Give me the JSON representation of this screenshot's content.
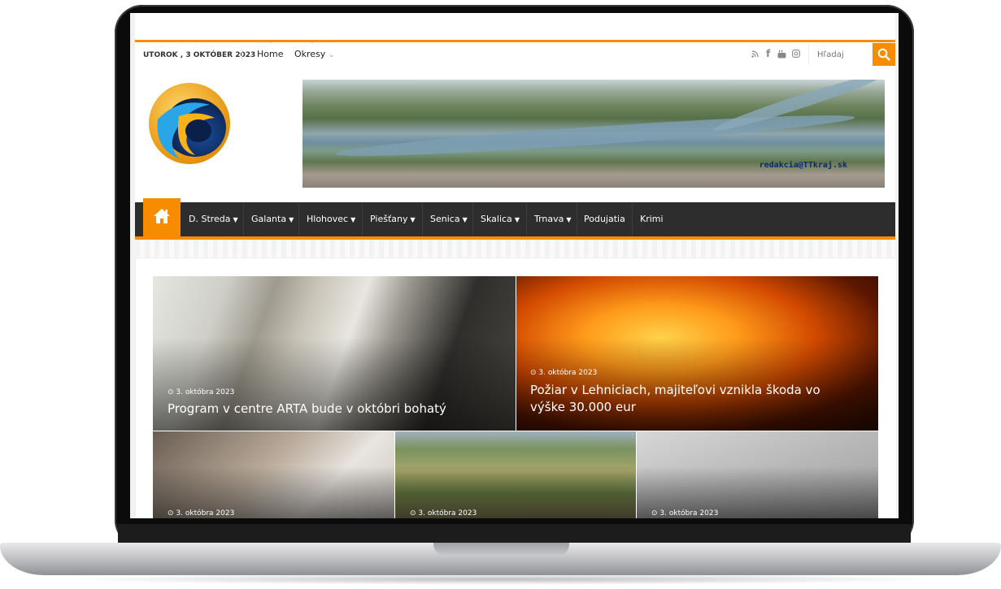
{
  "topbar": {
    "date": "UTOROK , 3 OKTÓBER 2023",
    "links": [
      {
        "label": "Home"
      },
      {
        "label": "Okresy"
      }
    ],
    "social_icons": [
      "rss-icon",
      "facebook-icon",
      "youtube-icon",
      "instagram-icon"
    ],
    "search_placeholder": "Hľadaj"
  },
  "header": {
    "banner_email": "redakcia@TTkraj.sk"
  },
  "nav": {
    "items": [
      {
        "label": "D. Streda",
        "dropdown": true
      },
      {
        "label": "Galanta",
        "dropdown": true
      },
      {
        "label": "Hlohovec",
        "dropdown": true
      },
      {
        "label": "Piešťany",
        "dropdown": true
      },
      {
        "label": "Senica",
        "dropdown": true
      },
      {
        "label": "Skalica",
        "dropdown": true
      },
      {
        "label": "Trnava",
        "dropdown": true
      },
      {
        "label": "Podujatia",
        "dropdown": false
      },
      {
        "label": "Krimi",
        "dropdown": false
      }
    ]
  },
  "featured": [
    {
      "date": "3. októbra 2023",
      "title": "Program v centre ARTA bude v októbri bohatý"
    },
    {
      "date": "3. októbra 2023",
      "title_line1": "Požiar v Lehniciach, majiteľovi vznikla škoda vo",
      "title_line2": "výške 30.000 eur"
    },
    {
      "date": "3. októbra 2023"
    },
    {
      "date": "3. októbra 2023"
    },
    {
      "date": "3. októbra 2023"
    }
  ],
  "colors": {
    "accent": "#f88c00",
    "nav_bg": "#2d2d2d"
  }
}
